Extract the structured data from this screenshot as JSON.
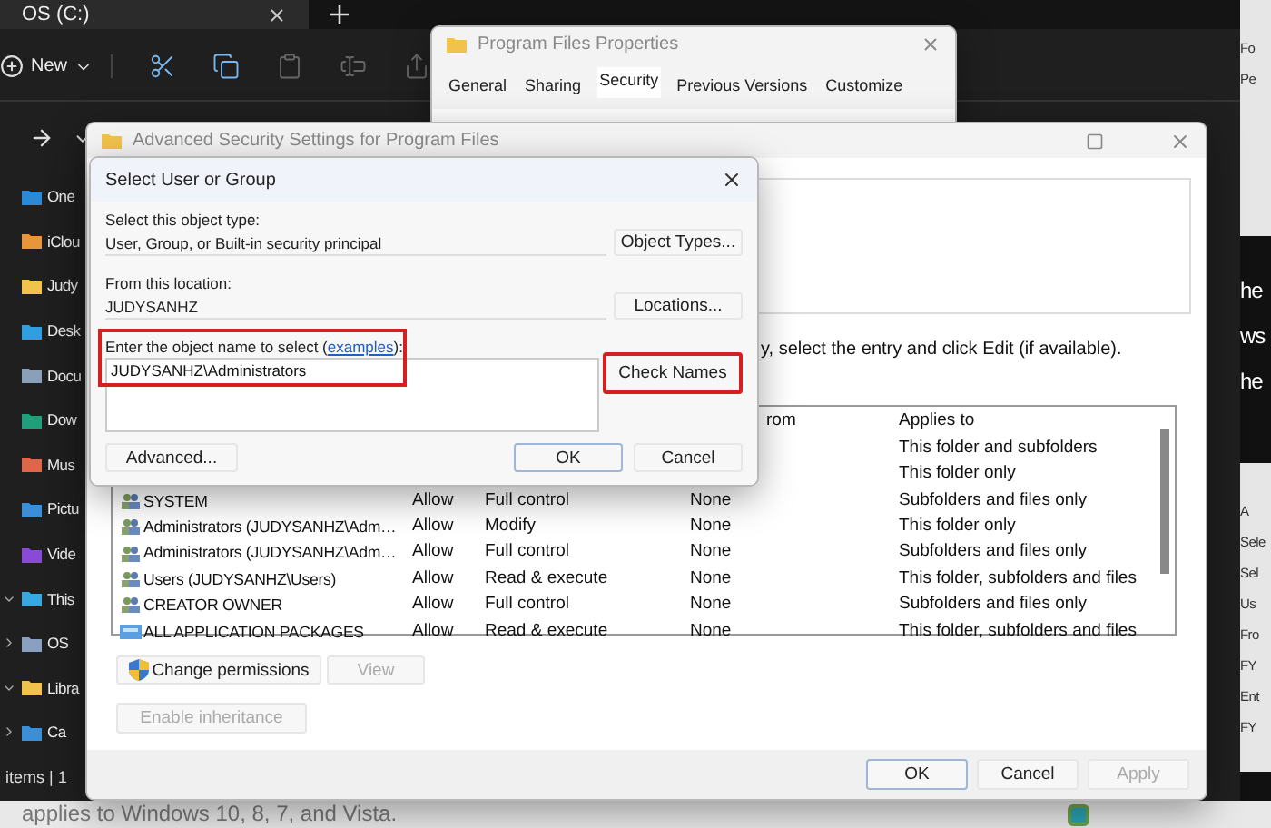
{
  "explorer": {
    "tab": "OS (C:)",
    "new_button": "New",
    "sidebar": [
      {
        "label": "One",
        "color": "#2b8ad8",
        "kind": "leaf"
      },
      {
        "label": "iClou",
        "color": "#e8963c",
        "kind": "leaf"
      },
      {
        "label": "Judy",
        "color": "#f1c34c",
        "kind": "leaf"
      },
      {
        "label": "Desk",
        "color": "#2f9fe0",
        "kind": "leaf"
      },
      {
        "label": "Docu",
        "color": "#8aa0b8",
        "kind": "leaf"
      },
      {
        "label": "Dow",
        "color": "#1fa07a",
        "kind": "leaf"
      },
      {
        "label": "Mus",
        "color": "#e0664a",
        "kind": "leaf"
      },
      {
        "label": "Pictu",
        "color": "#3a8fd6",
        "kind": "leaf"
      },
      {
        "label": "Vide",
        "color": "#8a4ad6",
        "kind": "leaf"
      },
      {
        "label": "This",
        "color": "#3aa8e0",
        "kind": "expanded"
      },
      {
        "label": "OS",
        "color": "#8aa0c0",
        "kind": "collapsed"
      },
      {
        "label": "Libra",
        "color": "#f1c34c",
        "kind": "expanded"
      },
      {
        "label": "Ca",
        "color": "#3a8fd6",
        "kind": "collapsed"
      }
    ],
    "status": "items | 1"
  },
  "side_page": {
    "top_panel": [
      "Fo",
      "Pe"
    ],
    "headings": [
      "he",
      "ws",
      "he"
    ],
    "lower_panel": [
      "A",
      "Sele",
      "Sel",
      "Us",
      "Fro",
      "FY",
      "Ent",
      "FY"
    ]
  },
  "properties_window": {
    "title": "Program Files Properties",
    "tabs": [
      {
        "label": "General",
        "selected": false
      },
      {
        "label": "Sharing",
        "selected": false
      },
      {
        "label": "Security",
        "selected": true
      },
      {
        "label": "Previous Versions",
        "selected": false
      },
      {
        "label": "Customize",
        "selected": false
      }
    ]
  },
  "advanced_window": {
    "title": "Advanced Security Settings for Program Files",
    "notice": "y, select the entry and click Edit (if available).",
    "columns": [
      "rom",
      "Applies to"
    ],
    "rows": [
      {
        "applies_to": "This folder and subfolders"
      },
      {
        "applies_to": "This folder only"
      },
      {
        "kind": "group",
        "principal": "SYSTEM",
        "access": "Allow",
        "permission": "Full control",
        "inherited": "None",
        "applies_to": "Subfolders and files only"
      },
      {
        "kind": "group",
        "principal": "Administrators (JUDYSANHZ\\Adm…",
        "access": "Allow",
        "permission": "Modify",
        "inherited": "None",
        "applies_to": "This folder only"
      },
      {
        "kind": "group",
        "principal": "Administrators (JUDYSANHZ\\Adm…",
        "access": "Allow",
        "permission": "Full control",
        "inherited": "None",
        "applies_to": "Subfolders and files only"
      },
      {
        "kind": "group",
        "principal": "Users (JUDYSANHZ\\Users)",
        "access": "Allow",
        "permission": "Read & execute",
        "inherited": "None",
        "applies_to": "This folder, subfolders and files"
      },
      {
        "kind": "group",
        "principal": "CREATOR OWNER",
        "access": "Allow",
        "permission": "Full control",
        "inherited": "None",
        "applies_to": "Subfolders and files only"
      },
      {
        "kind": "package",
        "principal": "ALL APPLICATION PACKAGES",
        "access": "Allow",
        "permission": "Read & execute",
        "inherited": "None",
        "applies_to": "This folder, subfolders and files"
      }
    ],
    "buttons": [
      {
        "label": "Change permissions",
        "kind": "shield",
        "disabled": false
      },
      {
        "label": "View",
        "kind": "plain",
        "disabled": true
      }
    ],
    "inheritance_button": {
      "label": "Enable inheritance",
      "disabled": true
    },
    "footer_buttons": [
      {
        "label": "OK",
        "default": true,
        "disabled": false
      },
      {
        "label": "Cancel",
        "default": false,
        "disabled": false
      },
      {
        "label": "Apply",
        "default": false,
        "disabled": true
      }
    ]
  },
  "dialog": {
    "title": "Select User or Group",
    "object_type_label": "Select this object type:",
    "object_type": "User, Group, or Built-in security principal",
    "object_types_button": "Object Types...",
    "location_label": "From this location:",
    "location": "JUDYSANHZ",
    "locations_button": "Locations...",
    "name_label": {
      "before": "Enter the object name to select (",
      "link": "examples",
      "after": "):",
      "highlighted": true
    },
    "name_value": "JUDYSANHZ\\Administrators",
    "check_names": {
      "label": "Check Names",
      "highlighted": true
    },
    "advanced_button": "Advanced...",
    "ok_button": "OK",
    "cancel_button": "Cancel"
  },
  "article_text": "applies to Windows 10, 8, 7, and Vista."
}
